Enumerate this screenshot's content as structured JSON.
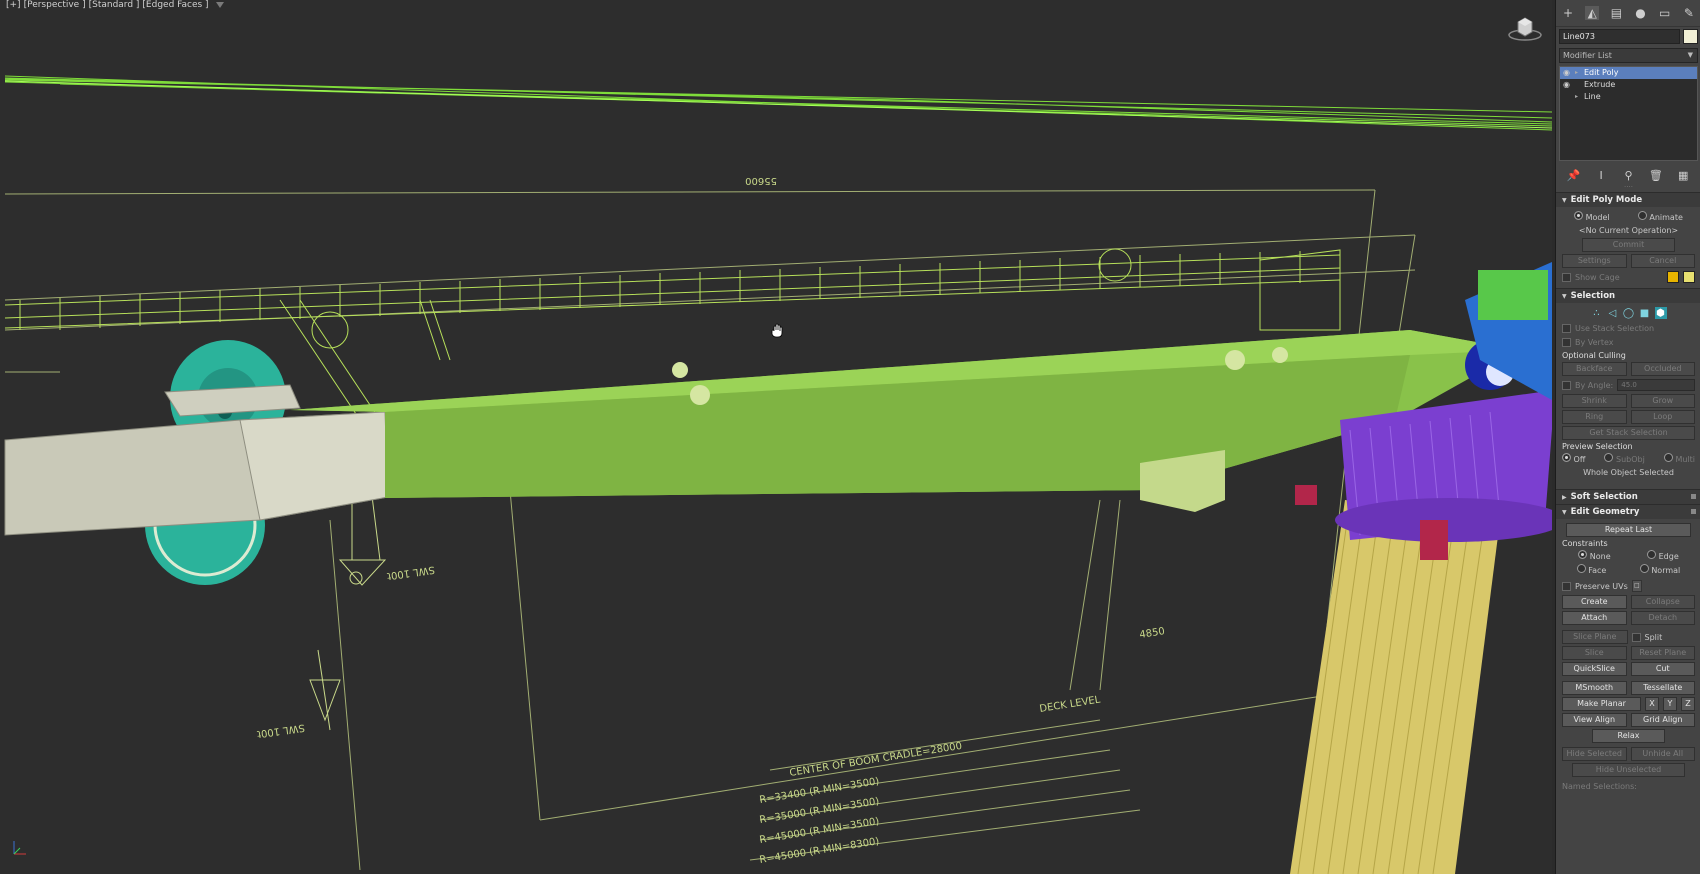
{
  "viewport": {
    "label_segments": [
      "[+]",
      "[Perspective ]",
      "[Standard ]",
      "[Edged Faces ]"
    ],
    "annotations": {
      "dim_top": "55600",
      "swl_left": "SWL 100t",
      "swl_bottom": "SWL 100t",
      "center_boom": "CENTER OF BOOM CRADLE=28000",
      "radius_1": "R=33400 (R MIN=3500)",
      "radius_2": "R=35000 (R MIN=3500)",
      "radius_3": "R=45000 (R MIN=3500)",
      "radius_4": "R=45000 (R MIN=8300)",
      "level_text": "DECK LEVEL",
      "dim_mid": "4850"
    }
  },
  "command_panel": {
    "tabs": [
      "create-icon",
      "modify-icon",
      "hierarchy-icon",
      "motion-icon",
      "display-icon",
      "utilities-icon"
    ],
    "object_name": "Line073",
    "object_color": "#f2f0d6",
    "modifier_list_label": "Modifier List",
    "stack": [
      {
        "label": "Edit Poly",
        "selected": true
      },
      {
        "label": "Extrude",
        "selected": false
      },
      {
        "label": "Line",
        "selected": false
      }
    ],
    "edit_poly_mode": {
      "title": "Edit Poly Mode",
      "model_label": "Model",
      "animate_label": "Animate",
      "current_op": "<No Current Operation>",
      "commit_label": "Commit",
      "settings_label": "Settings",
      "cancel_label": "Cancel",
      "show_cage_label": "Show Cage",
      "cage_color_1": "#e8b400",
      "cage_color_2": "#e8e070"
    },
    "selection": {
      "title": "Selection",
      "use_stack_label": "Use Stack Selection",
      "by_vertex_label": "By Vertex",
      "optional_culling_label": "Optional Culling",
      "backface_label": "Backface",
      "occluded_label": "Occluded",
      "by_angle_label": "By Angle:",
      "by_angle_value": "45.0",
      "shrink_label": "Shrink",
      "grow_label": "Grow",
      "ring_label": "Ring",
      "loop_label": "Loop",
      "get_stack_label": "Get Stack Selection",
      "preview_label": "Preview Selection",
      "off_label": "Off",
      "subobj_label": "SubObj",
      "multi_label": "Multi",
      "status": "Whole Object Selected"
    },
    "soft_selection": {
      "title": "Soft Selection"
    },
    "edit_geometry": {
      "title": "Edit Geometry",
      "repeat_last": "Repeat Last",
      "constraints_label": "Constraints",
      "none_label": "None",
      "edge_label": "Edge",
      "face_label": "Face",
      "normal_label": "Normal",
      "preserve_uvs": "Preserve UVs",
      "create": "Create",
      "collapse": "Collapse",
      "attach": "Attach",
      "detach": "Detach",
      "slice_plane": "Slice Plane",
      "split": "Split",
      "slice": "Slice",
      "reset_plane": "Reset Plane",
      "quickslice": "QuickSlice",
      "cut": "Cut",
      "msmooth": "MSmooth",
      "tessellate": "Tessellate",
      "make_planar": "Make Planar",
      "x": "X",
      "y": "Y",
      "z": "Z",
      "view_align": "View Align",
      "grid_align": "Grid Align",
      "relax": "Relax",
      "hide_selected": "Hide Selected",
      "unhide_all": "Unhide All",
      "hide_unselected": "Hide Unselected",
      "named_selections": "Named Selections:"
    }
  }
}
